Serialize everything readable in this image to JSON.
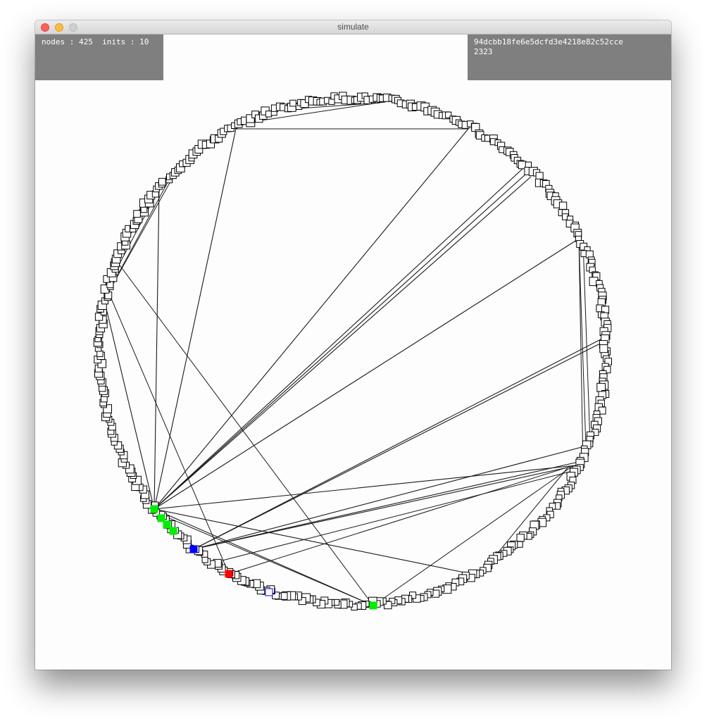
{
  "window": {
    "title": "simulate"
  },
  "stats": {
    "nodes_label": "nodes : ",
    "nodes": "425",
    "inits_label": "  inits : ",
    "inits": "10"
  },
  "hash": {
    "line1": "94dcbb18fe6e5dcfd3e4218e82c52cce",
    "line2": "2323"
  },
  "graph": {
    "layout": "circular",
    "node_count": 425,
    "colors": {
      "node_fill": "#ffffff",
      "node_stroke": "#000000",
      "edge": "#1a1a1a",
      "init_green": "#00ee00",
      "blue": "#0000ff",
      "red": "#ff0000"
    }
  }
}
